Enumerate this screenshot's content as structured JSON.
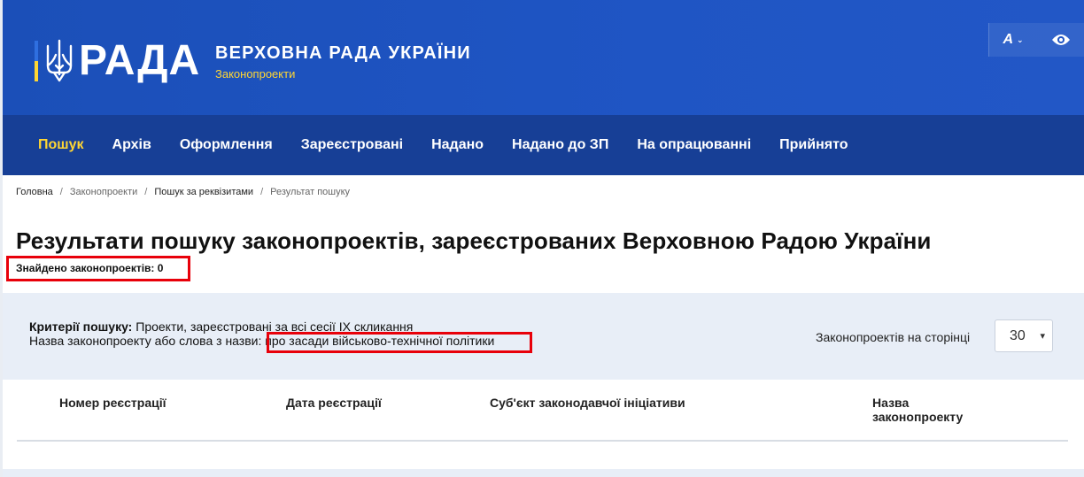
{
  "header": {
    "logo_word": "РАДА",
    "org_title": "ВЕРХОВНА РАДА УКРАЇНИ",
    "org_subtitle": "Законопроекти",
    "font_size_btn": "A",
    "icons": [
      "trident-icon",
      "chevron-down-icon",
      "eye-icon"
    ],
    "colors": {
      "header_bg": "#1f55c4",
      "nav_bg": "#173f96",
      "accent": "#ffd633"
    }
  },
  "nav": {
    "items": [
      {
        "label": "Пошук",
        "active": true
      },
      {
        "label": "Архів"
      },
      {
        "label": "Оформлення"
      },
      {
        "label": "Зареєстровані"
      },
      {
        "label": "Надано"
      },
      {
        "label": "Надано до ЗП"
      },
      {
        "label": "На опрацюванні"
      },
      {
        "label": "Прийнято"
      }
    ]
  },
  "breadcrumb": {
    "items": [
      "Головна",
      "Законопроекти",
      "Пошук за реквізитами",
      "Результат пошуку"
    ],
    "separator": "/"
  },
  "main": {
    "title": "Результати пошуку законопроектів, зареєстрованих Верховною Радою України",
    "found_text": "Знайдено законопроектів: 0"
  },
  "criteria": {
    "label": "Критерії пошуку:",
    "line1_value": "Проекти, зареєстровані за всі сесії IX скликання",
    "line2_label": "Назва законопроекту або слова з назви:",
    "line2_value": "про засади військово-технічної політики",
    "perpage_label": "Законопроектів на сторінці",
    "perpage_value": "30"
  },
  "table": {
    "columns": [
      "Номер реєстрації",
      "Дата реєстрації",
      "Суб'єкт законодавчої ініціативи",
      "Назва законопроекту"
    ]
  }
}
